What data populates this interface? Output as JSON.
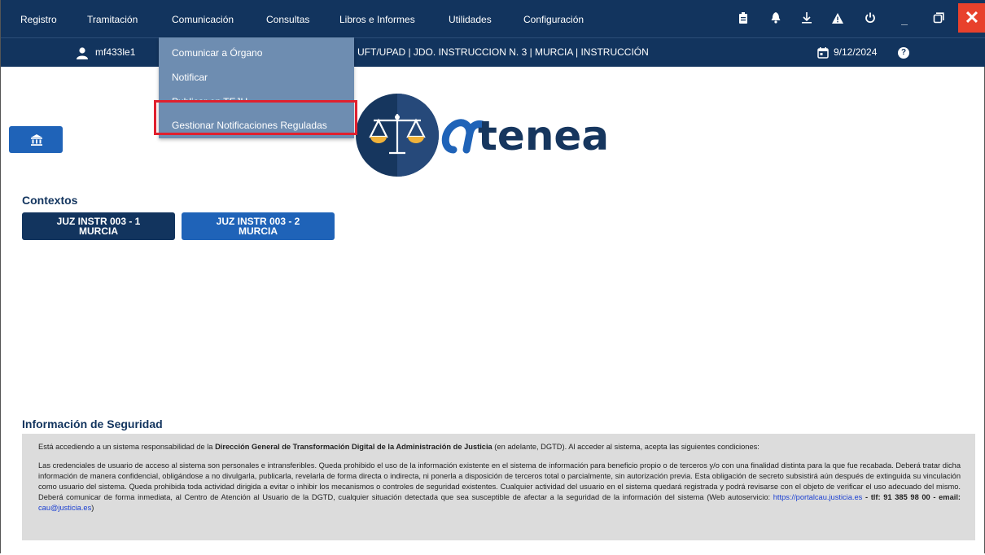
{
  "menu": {
    "items": [
      "Registro",
      "Tramitación",
      "Comunicación",
      "Consultas",
      "Libros e Informes",
      "Utilidades",
      "Configuración"
    ]
  },
  "toolbar": {
    "icons": [
      "clipboard-icon",
      "bell-icon",
      "download-icon",
      "warning-icon",
      "power-icon",
      "minimize-icon",
      "restore-icon",
      "close-icon"
    ],
    "minimize_glyph": "_",
    "close_glyph": "✕"
  },
  "user": {
    "name": "mf433le1",
    "context": "UFT/UPAD | JDO. INSTRUCCION N. 3 | MURCIA | INSTRUCCIÓN",
    "date": "9/12/2024",
    "help_glyph": "?"
  },
  "dropdown": {
    "items": [
      "Comunicar a Órgano",
      "Notificar",
      "Publicar en TEJU",
      "Gestionar Notificaciones Reguladas"
    ]
  },
  "logo": {
    "text": "tenea"
  },
  "contexts": {
    "title": "Contextos",
    "buttons": [
      {
        "line1": "JUZ INSTR 003 - 1",
        "line2": "MURCIA"
      },
      {
        "line1": "JUZ INSTR 003 - 2",
        "line2": "MURCIA"
      }
    ]
  },
  "security": {
    "title": "Información de Seguridad",
    "intro_pre": "Está accediendo a un sistema responsabilidad de la ",
    "intro_bold": "Dirección General de Transformación Digital de la Administración de Justicia",
    "intro_post": " (en adelante, DGTD). Al acceder al sistema, acepta las siguientes condiciones:",
    "body": "Las credenciales de usuario de acceso al sistema son personales e intransferibles. Queda prohibido el uso de la información existente en el sistema de información para beneficio propio o de terceros y/o con una finalidad distinta para la que fue recabada. Deberá tratar dicha información de manera confidencial, obligándose a no divulgarla, publicarla, revelarla de forma directa o indirecta, ni ponerla a disposición de terceros total o parcialmente, sin autorización previa. Esta obligación de secreto subsistirá aún después de extinguida su vinculación como usuario del sistema. Queda prohibida toda actividad dirigida a evitar o inhibir los mecanismos o controles de seguridad existentes. Cualquier actividad del usuario en el sistema quedará registrada y podrá revisarse con el objeto de verificar el uso adecuado del mismo. Deberá comunicar de forma inmediata, al Centro de Atención al Usuario de la DGTD, cualquier situación detectada que sea susceptible de afectar a la seguridad de la información del sistema (Web autoservicio: ",
    "web_link": "https://portalcau.justicia.es",
    "tlf_label": " - tlf: 91 385 98 00 - email: ",
    "email": "cau@justicia.es",
    "closing": ")"
  },
  "colors": {
    "header": "#12345e",
    "dropdown": "#6e8db1",
    "accent": "#1f63b8",
    "highlight": "#e0202e",
    "close": "#e8412c"
  }
}
